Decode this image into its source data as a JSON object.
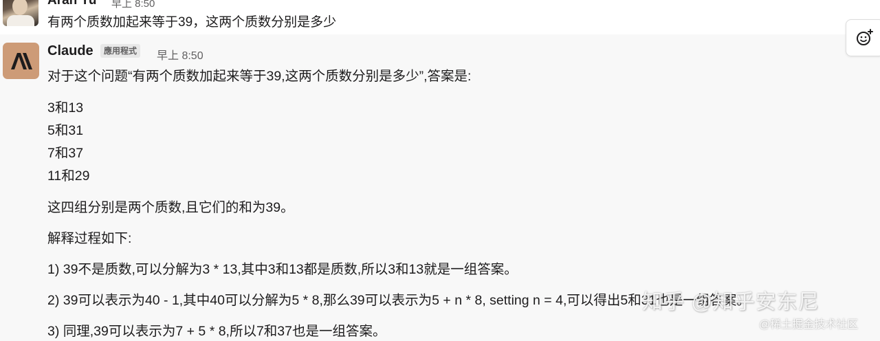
{
  "message1": {
    "author": "Aran Yu",
    "time": "早上 8:50",
    "text": "有两个质数加起来等于39，这两个质数分别是多少"
  },
  "message2": {
    "author": "Claude",
    "badge": "應用程式",
    "time": "早上 8:50",
    "avatar_text": "A\\",
    "lines": [
      "对于这个问题“有两个质数加起来等于39,这两个质数分别是多少”,答案是:",
      "3和13",
      "5和31",
      "7和37",
      "11和29",
      "这四组分别是两个质数,且它们的和为39。",
      "解释过程如下:",
      "1) 39不是质数,可以分解为3 * 13,其中3和13都是质数,所以3和13就是一组答案。",
      "2) 39可以表示为40 - 1,其中40可以分解为5 * 8,那么39可以表示为5 + n * 8, setting n = 4,可以得出5和31也是一组答案。",
      "3) 同理,39可以表示为7 + 5 * 8,所以7和37也是一组答案。"
    ]
  },
  "reaction_icon": "add-reaction-icon",
  "watermarks": {
    "zhihu": "知乎 @知乎安东尼",
    "juejin": "@稀土掘金技术社区"
  },
  "colors": {
    "claude_avatar_bg": "#cd9b77",
    "message_hover_bg": "#f8f8f8",
    "text": "#1d1c1d",
    "muted": "#616061"
  }
}
